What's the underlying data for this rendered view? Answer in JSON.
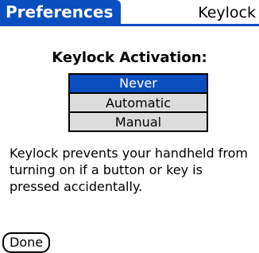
{
  "colors": {
    "accent": "#0A4EBF",
    "list_background": "#DCDCDC",
    "text": "#000000",
    "background": "#FFFFFF"
  },
  "header": {
    "app_title": "Preferences",
    "panel": "Keylock"
  },
  "section_title": "Keylock Activation:",
  "options": [
    {
      "label": "Never",
      "selected": true
    },
    {
      "label": "Automatic",
      "selected": false
    },
    {
      "label": "Manual",
      "selected": false
    }
  ],
  "description": "Keylock prevents your handheld from turning on if a button or key is pressed accidentally.",
  "buttons": {
    "done": "Done"
  }
}
